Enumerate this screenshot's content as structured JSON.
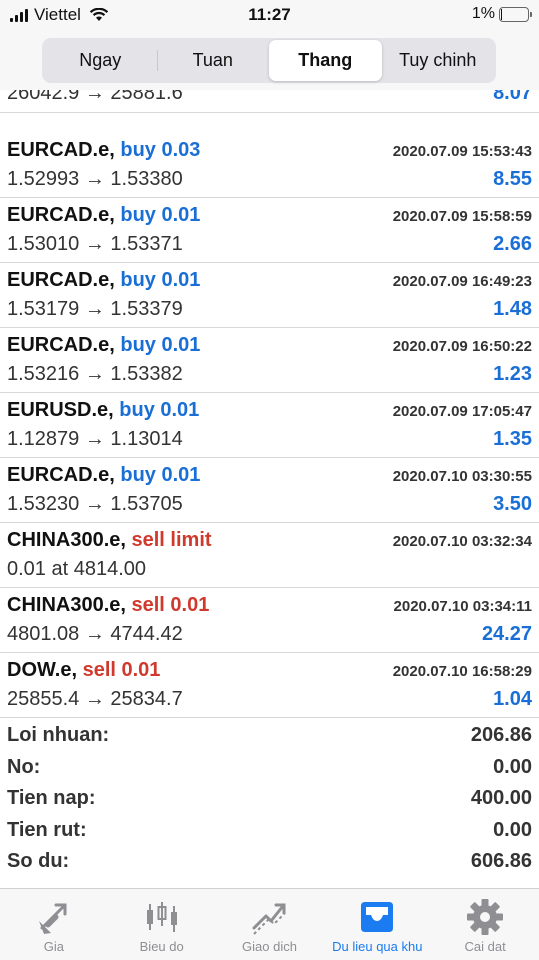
{
  "status_bar": {
    "carrier": "Viettel",
    "time": "11:27",
    "battery": "1%"
  },
  "segments": [
    {
      "label": "Ngay",
      "active": false
    },
    {
      "label": "Tuan",
      "active": false
    },
    {
      "label": "Thang",
      "active": true
    },
    {
      "label": "Tuy chinh",
      "active": false
    }
  ],
  "partial_row": {
    "prices": "26042.9 → 25881.6",
    "profit": "8.07"
  },
  "trades": [
    {
      "symbol": "EURCAD.e,",
      "direction": "buy 0.03",
      "type": "buy",
      "datetime": "2020.07.09 15:53:43",
      "prices": "1.52993 → 1.53380",
      "profit": "8.55"
    },
    {
      "symbol": "EURCAD.e,",
      "direction": "buy 0.01",
      "type": "buy",
      "datetime": "2020.07.09 15:58:59",
      "prices": "1.53010 → 1.53371",
      "profit": "2.66"
    },
    {
      "symbol": "EURCAD.e,",
      "direction": "buy 0.01",
      "type": "buy",
      "datetime": "2020.07.09 16:49:23",
      "prices": "1.53179 → 1.53379",
      "profit": "1.48"
    },
    {
      "symbol": "EURCAD.e,",
      "direction": "buy 0.01",
      "type": "buy",
      "datetime": "2020.07.09 16:50:22",
      "prices": "1.53216 → 1.53382",
      "profit": "1.23"
    },
    {
      "symbol": "EURUSD.e,",
      "direction": "buy 0.01",
      "type": "buy",
      "datetime": "2020.07.09 17:05:47",
      "prices": "1.12879 → 1.13014",
      "profit": "1.35"
    },
    {
      "symbol": "EURCAD.e,",
      "direction": "buy 0.01",
      "type": "buy",
      "datetime": "2020.07.10 03:30:55",
      "prices": "1.53230 → 1.53705",
      "profit": "3.50"
    },
    {
      "symbol": "CHINA300.e,",
      "direction": "sell limit",
      "type": "sell",
      "datetime": "2020.07.10 03:32:34",
      "prices": "0.01 at 4814.00",
      "profit": ""
    },
    {
      "symbol": "CHINA300.e,",
      "direction": "sell 0.01",
      "type": "sell",
      "datetime": "2020.07.10 03:34:11",
      "prices": "4801.08 → 4744.42",
      "profit": "24.27"
    },
    {
      "symbol": "DOW.e,",
      "direction": "sell 0.01",
      "type": "sell",
      "datetime": "2020.07.10 16:58:29",
      "prices": "25855.4 → 25834.7",
      "profit": "1.04"
    }
  ],
  "summary": [
    {
      "label": "Loi nhuan:",
      "value": "206.86"
    },
    {
      "label": "No:",
      "value": "0.00"
    },
    {
      "label": "Tien nap:",
      "value": "400.00"
    },
    {
      "label": "Tien rut:",
      "value": "0.00"
    },
    {
      "label": "So du:",
      "value": "606.86"
    }
  ],
  "tabs": [
    {
      "label": "Gia",
      "icon": "quotes-arrows-icon",
      "active": false
    },
    {
      "label": "Bieu do",
      "icon": "candlestick-chart-icon",
      "active": false
    },
    {
      "label": "Giao dich",
      "icon": "trade-chart-icon",
      "active": false
    },
    {
      "label": "Du lieu qua khu",
      "icon": "history-tray-icon",
      "active": true
    },
    {
      "label": "Cai dat",
      "icon": "gear-icon",
      "active": false
    }
  ],
  "colors": {
    "accent": "#1a7cf0",
    "buy": "#1a6fd6",
    "sell": "#d03a2e",
    "inactive": "#8e8e93"
  }
}
